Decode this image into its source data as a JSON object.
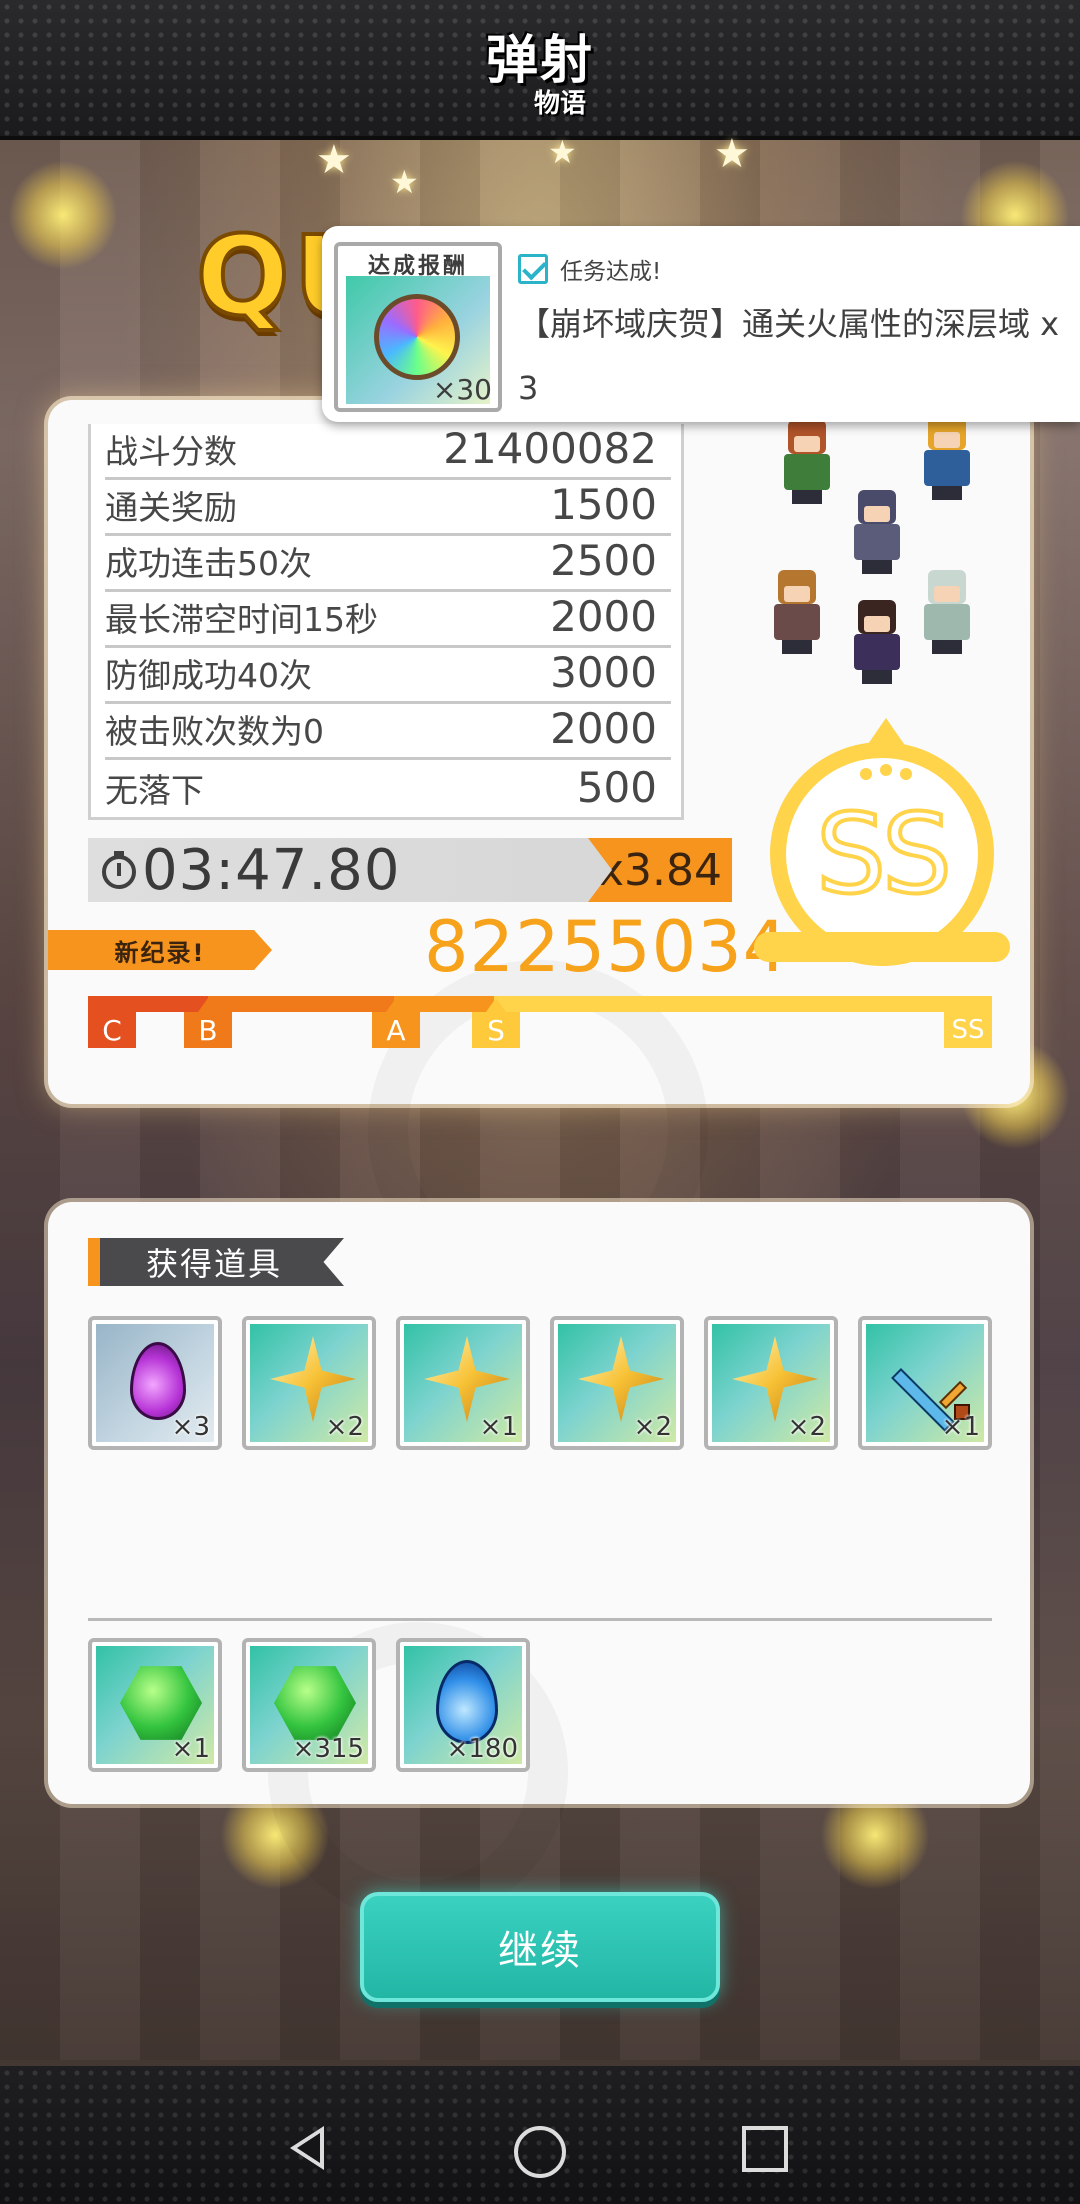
{
  "app": {
    "logo_main": "弹射",
    "logo_sub": "物语",
    "title_partial": "QU"
  },
  "quest_popup": {
    "reward_label": "达成报酬",
    "reward_count": "×30",
    "reward_icon": "rainbow-orb-icon",
    "status": "任务达成!",
    "description": "【崩坏域庆贺】通关火属性的深层域 x 3"
  },
  "result": {
    "score_rows": [
      {
        "label": "战斗分数",
        "value": "21400082"
      },
      {
        "label": "通关奖励",
        "value": "1500"
      },
      {
        "label": "成功连击50次",
        "value": "2500"
      },
      {
        "label": "最长滞空时间15秒",
        "value": "2000"
      },
      {
        "label": "防御成功40次",
        "value": "3000"
      },
      {
        "label": "被击败次数为0",
        "value": "2000"
      },
      {
        "label": "无落下",
        "value": "500"
      }
    ],
    "time": "03:47.80",
    "multiplier": "x3.84",
    "new_record": "新纪录!",
    "total_score": "82255034",
    "rank": "SS",
    "rank_markers": [
      "C",
      "B",
      "A",
      "S",
      "SS"
    ],
    "colors": {
      "rank_c": "#e4501f",
      "rank_b": "#f07a1a",
      "rank_a": "#f7941d",
      "rank_s": "#ffc93c",
      "rank_ss": "#ffd34a"
    }
  },
  "items": {
    "header": "获得道具",
    "row1": [
      {
        "icon": "purple-gem-icon",
        "qty": "×3"
      },
      {
        "icon": "gold-star-shard-icon",
        "qty": "×2"
      },
      {
        "icon": "gold-star-shard-icon",
        "qty": "×1"
      },
      {
        "icon": "gold-star-shard-icon",
        "qty": "×2"
      },
      {
        "icon": "gold-star-shard-icon",
        "qty": "×2"
      },
      {
        "icon": "sword-icon",
        "qty": "×1"
      }
    ],
    "row2": [
      {
        "icon": "green-gem-icon",
        "qty": "×1"
      },
      {
        "icon": "green-gem-icon",
        "qty": "×315"
      },
      {
        "icon": "blue-drop-icon",
        "qty": "×180"
      }
    ]
  },
  "continue_label": "继续",
  "nav": {
    "back_icon": "back-icon",
    "home_icon": "home-icon",
    "recent_icon": "recent-apps-icon"
  }
}
